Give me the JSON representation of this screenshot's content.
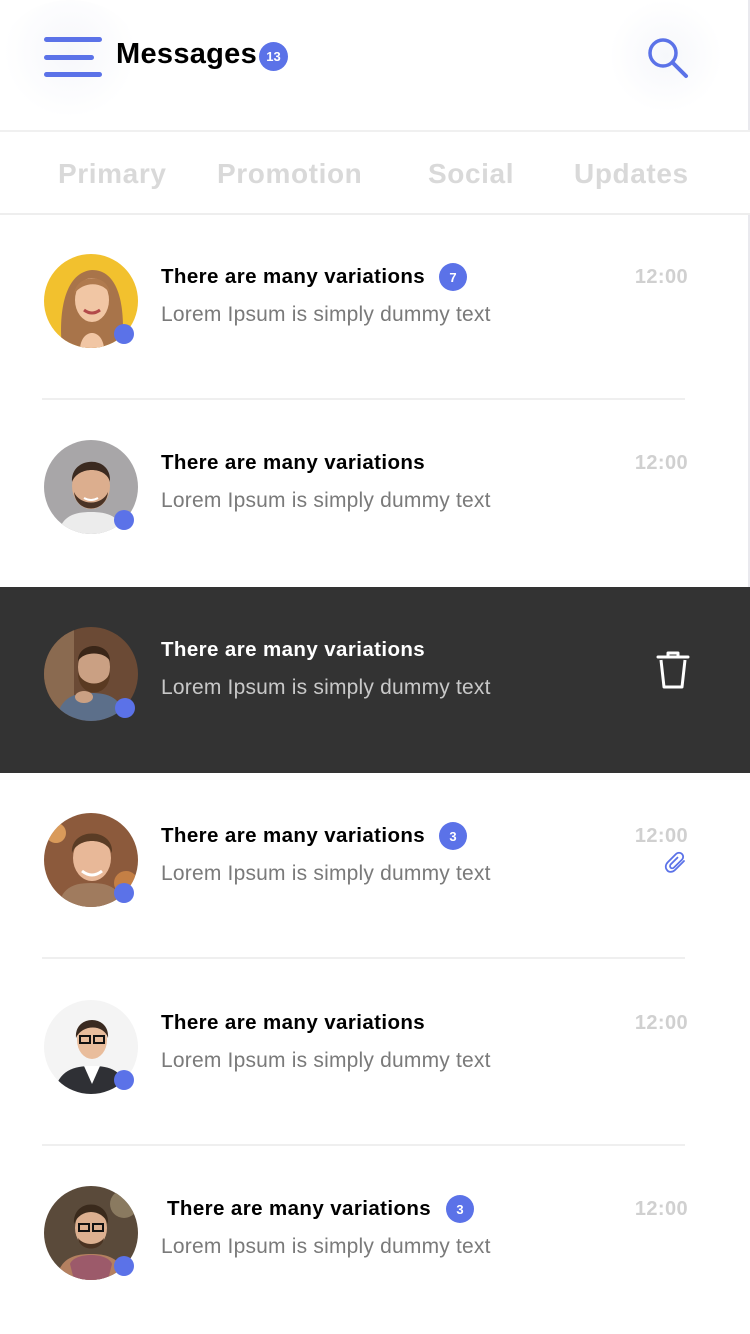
{
  "header": {
    "title": "Messages",
    "count": "13",
    "menu_icon": "hamburger-menu-icon",
    "search_icon": "search-icon"
  },
  "tabs": [
    {
      "label": "Primary"
    },
    {
      "label": "Promotion"
    },
    {
      "label": "Social"
    },
    {
      "label": "Updates"
    }
  ],
  "colors": {
    "accent": "#5b72e8",
    "swipe_background": "#333333",
    "tab_inactive": "#d9d9d9"
  },
  "messages": [
    {
      "title": "There are many variations",
      "preview": "Lorem Ipsum is simply dummy text",
      "time": "12:00",
      "unread": "7",
      "online": true
    },
    {
      "title": "There are many variations",
      "preview": "Lorem Ipsum is simply dummy text",
      "time": "12:00",
      "unread": "",
      "online": true
    },
    {
      "title": "There are many variations",
      "preview": "Lorem Ipsum is simply dummy text",
      "action": "trash-icon",
      "online": true,
      "swiped": true
    },
    {
      "title": "There are many variations",
      "preview": "Lorem Ipsum is simply dummy text",
      "time": "12:00",
      "unread": "3",
      "attachment": "paperclip-icon",
      "online": true
    },
    {
      "title": "There are many variations",
      "preview": "Lorem Ipsum is simply dummy text",
      "time": "12:00",
      "unread": "",
      "online": true
    },
    {
      "title": "There are many variations",
      "preview": "Lorem Ipsum is simply dummy text",
      "time": "12:00",
      "unread": "3",
      "online": true
    }
  ]
}
